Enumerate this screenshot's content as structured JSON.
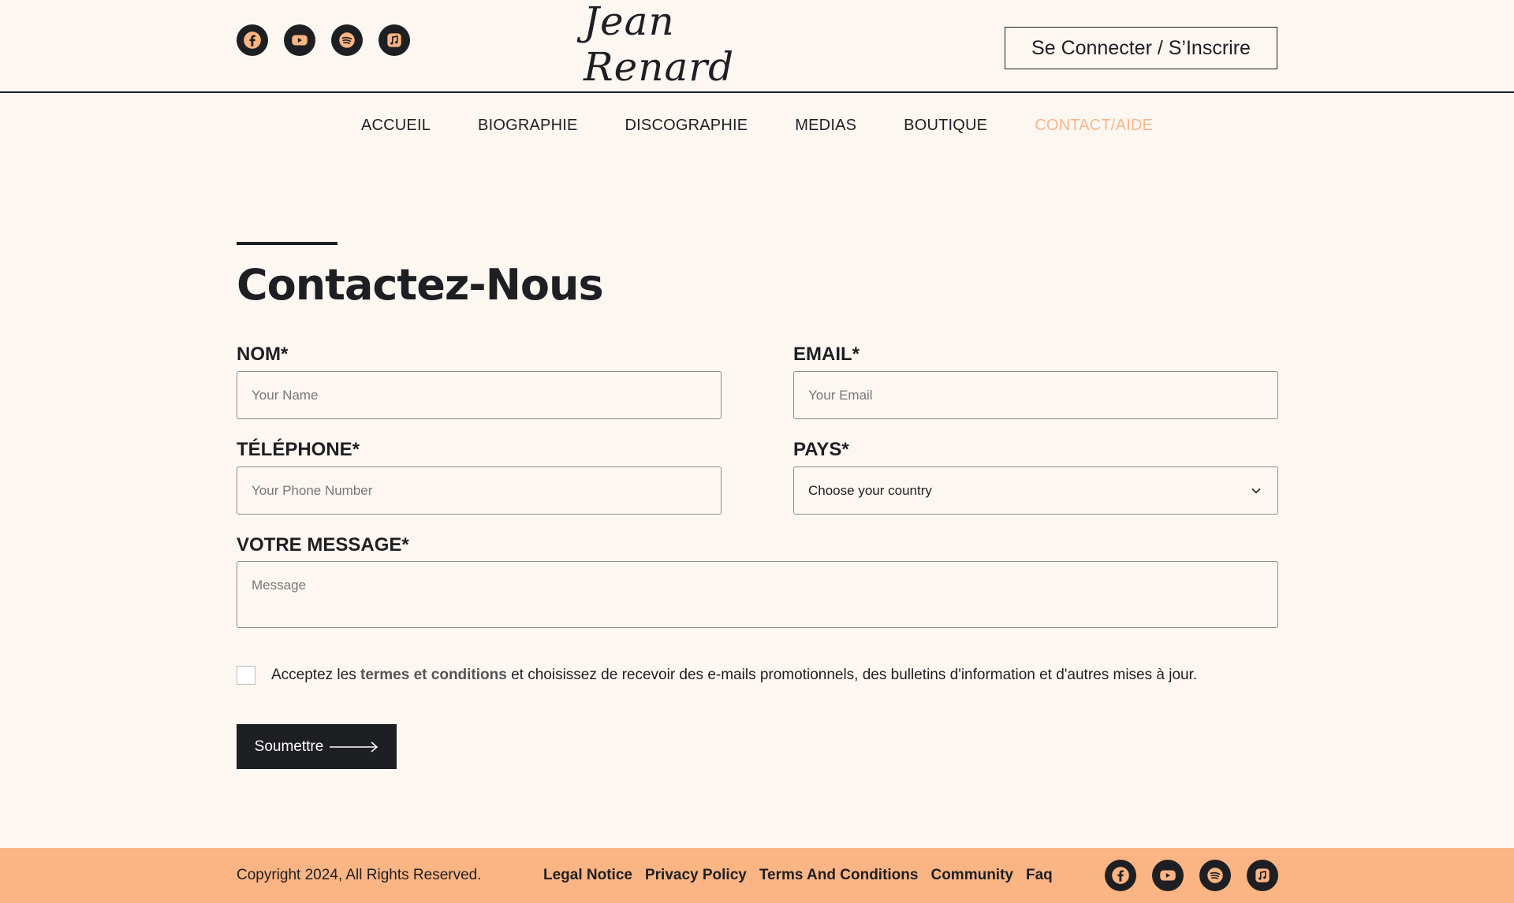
{
  "header": {
    "logo": "Jean Renard",
    "login_label": "Se Connecter / S’Inscrire",
    "social_icons": [
      "facebook-icon",
      "youtube-icon",
      "spotify-icon",
      "apple-music-icon"
    ]
  },
  "nav": {
    "items": [
      {
        "label": "ACCUEIL"
      },
      {
        "label": "BIOGRAPHIE"
      },
      {
        "label": "DISCOGRAPHIE"
      },
      {
        "label": "MEDIAS"
      },
      {
        "label": "BOUTIQUE"
      },
      {
        "label": "CONTACT/AIDE",
        "active": true
      }
    ]
  },
  "form": {
    "title": "Contactez-Nous",
    "name": {
      "label": "NOM*",
      "placeholder": "Your Name"
    },
    "email": {
      "label": "EMAIL*",
      "placeholder": "Your Email"
    },
    "phone": {
      "label": "TÉLÉPHONE*",
      "placeholder": "Your Phone Number"
    },
    "country": {
      "label": "PAYS*",
      "selected": "Choose your country"
    },
    "message": {
      "label": "VOTRE MESSAGE*",
      "placeholder": "Message"
    },
    "consent": {
      "prefix": "Acceptez les ",
      "link": "termes et conditions",
      "suffix": " et choisissez de recevoir des e-mails promotionnels, des bulletins d'information et d'autres mises à jour."
    },
    "submit_label": "Soumettre"
  },
  "footer": {
    "copyright": "Copyright 2024, All Rights Reserved.",
    "links": [
      {
        "label": "Legal Notice"
      },
      {
        "label": "Privacy Policy"
      },
      {
        "label": "Terms And Conditions"
      },
      {
        "label": "Community"
      },
      {
        "label": "Faq"
      }
    ]
  },
  "colors": {
    "background": "#fdf7f2",
    "accent": "#fbb584",
    "nav_active": "#f7b68a",
    "dark": "#1e1f22"
  }
}
